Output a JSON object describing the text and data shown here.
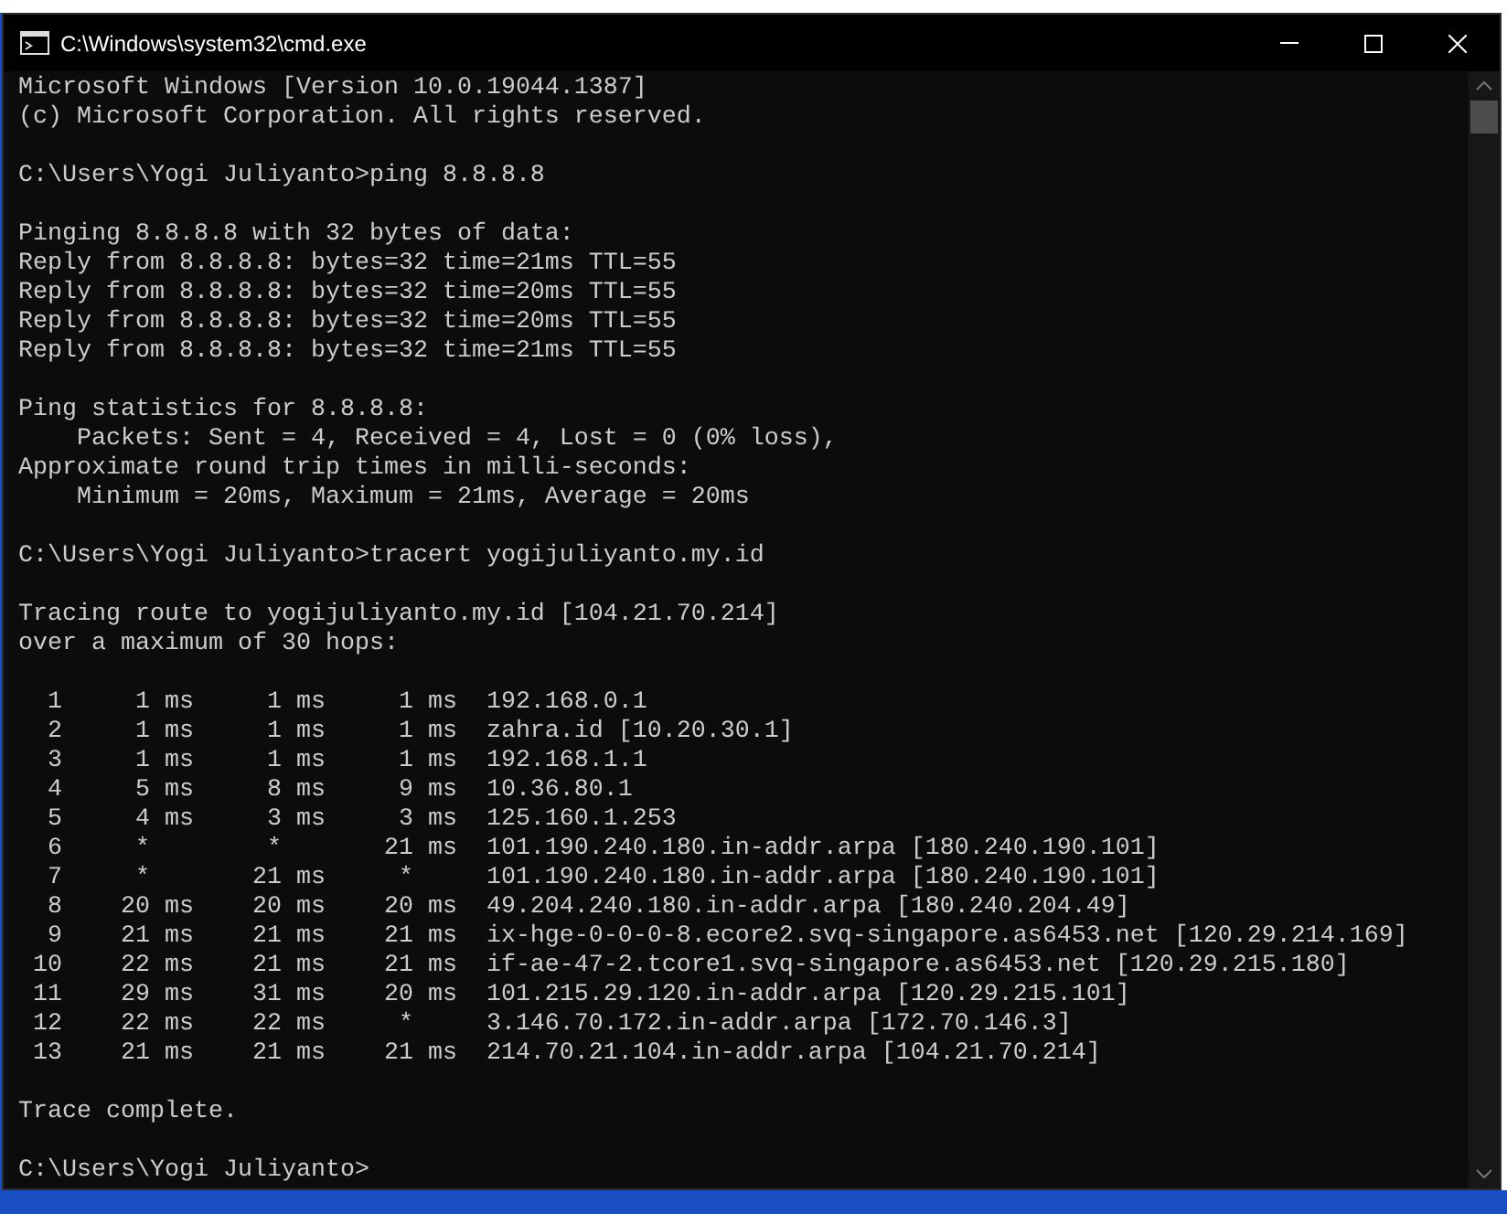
{
  "window": {
    "title": "C:\\Windows\\system32\\cmd.exe"
  },
  "console": {
    "blocks": [
      [
        "Microsoft Windows [Version 10.0.19044.1387]",
        "(c) Microsoft Corporation. All rights reserved."
      ],
      [
        "C:\\Users\\Yogi Juliyanto>ping 8.8.8.8"
      ],
      [
        "Pinging 8.8.8.8 with 32 bytes of data:",
        "Reply from 8.8.8.8: bytes=32 time=21ms TTL=55",
        "Reply from 8.8.8.8: bytes=32 time=20ms TTL=55",
        "Reply from 8.8.8.8: bytes=32 time=20ms TTL=55",
        "Reply from 8.8.8.8: bytes=32 time=21ms TTL=55"
      ],
      [
        "Ping statistics for 8.8.8.8:",
        "    Packets: Sent = 4, Received = 4, Lost = 0 (0% loss),",
        "Approximate round trip times in milli-seconds:",
        "    Minimum = 20ms, Maximum = 21ms, Average = 20ms"
      ],
      [
        "C:\\Users\\Yogi Juliyanto>tracert yogijuliyanto.my.id"
      ],
      [
        "Tracing route to yogijuliyanto.my.id [104.21.70.214]",
        "over a maximum of 30 hops:"
      ],
      [
        "  1     1 ms     1 ms     1 ms  192.168.0.1",
        "  2     1 ms     1 ms     1 ms  zahra.id [10.20.30.1]",
        "  3     1 ms     1 ms     1 ms  192.168.1.1",
        "  4     5 ms     8 ms     9 ms  10.36.80.1",
        "  5     4 ms     3 ms     3 ms  125.160.1.253",
        "  6     *        *       21 ms  101.190.240.180.in-addr.arpa [180.240.190.101]",
        "  7     *       21 ms     *     101.190.240.180.in-addr.arpa [180.240.190.101]",
        "  8    20 ms    20 ms    20 ms  49.204.240.180.in-addr.arpa [180.240.204.49]",
        "  9    21 ms    21 ms    21 ms  ix-hge-0-0-0-8.ecore2.svq-singapore.as6453.net [120.29.214.169]",
        " 10    22 ms    21 ms    21 ms  if-ae-47-2.tcore1.svq-singapore.as6453.net [120.29.215.180]",
        " 11    29 ms    31 ms    20 ms  101.215.29.120.in-addr.arpa [120.29.215.101]",
        " 12    22 ms    22 ms     *     3.146.70.172.in-addr.arpa [172.70.146.3]",
        " 13    21 ms    21 ms    21 ms  214.70.21.104.in-addr.arpa [104.21.70.214]"
      ],
      [
        "Trace complete."
      ],
      [
        "C:\\Users\\Yogi Juliyanto>"
      ]
    ]
  }
}
